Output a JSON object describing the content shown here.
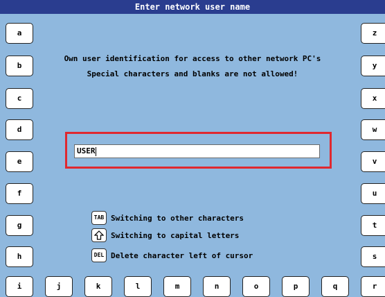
{
  "window": {
    "title": "Enter network user name"
  },
  "messages": {
    "line1": "Own user identification for access to other network PC's",
    "line2": "Special characters and blanks are not allowed!"
  },
  "input": {
    "value": "USER"
  },
  "keys": {
    "left": [
      "a",
      "b",
      "c",
      "d",
      "e",
      "f",
      "g",
      "h",
      "i"
    ],
    "right": [
      "z",
      "y",
      "x",
      "w",
      "v",
      "u",
      "t",
      "s",
      "r"
    ],
    "bottom": [
      "j",
      "k",
      "l",
      "m",
      "n",
      "o",
      "p",
      "q"
    ]
  },
  "help": [
    {
      "icon": "TAB",
      "text": "Switching to other characters"
    },
    {
      "icon": "shift-arrow",
      "text": "Switching to capital letters"
    },
    {
      "icon": "DEL",
      "text": "Delete character left of cursor"
    }
  ]
}
